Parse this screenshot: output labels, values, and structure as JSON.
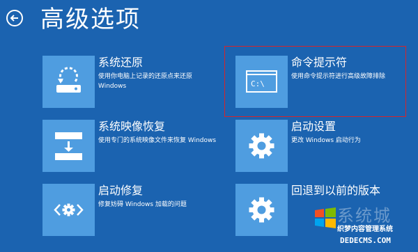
{
  "header": {
    "title": "高级选项"
  },
  "options": [
    {
      "title": "系统还原",
      "description": "使用你电脑上记录的还原点来还原 Windows",
      "icon": "system-restore-icon"
    },
    {
      "title": "命令提示符",
      "description": "使用命令提示符进行高级故障排除",
      "icon": "command-prompt-icon"
    },
    {
      "title": "系统映像恢复",
      "description": "使用专门的系统映像文件来恢复 Windows",
      "icon": "system-image-icon"
    },
    {
      "title": "启动设置",
      "description": "更改 Windows 启动行为",
      "icon": "gear-icon"
    },
    {
      "title": "启动修复",
      "description": "修复妨碍 Windows 加载的问题",
      "icon": "startup-repair-icon"
    },
    {
      "title": "回退到以前的版本",
      "description": "",
      "icon": "gear-icon"
    }
  ],
  "watermark": {
    "text": "系统城",
    "subtitle": "织梦内容管理系统",
    "url": "DEDECMS.COM"
  },
  "colors": {
    "background": "#1b63b0",
    "tile": "#4f9de0",
    "highlight": "#d7242a"
  }
}
